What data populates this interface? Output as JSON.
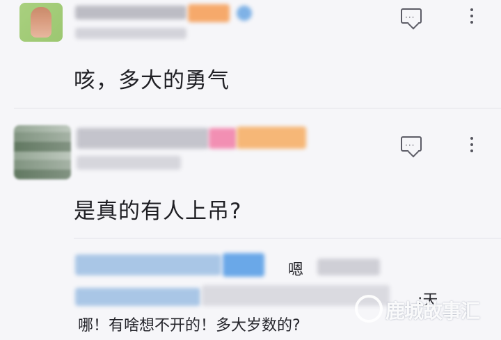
{
  "comments": [
    {
      "text": "咳，多大的勇气",
      "reply_icon": "comment-bubble-icon",
      "more_icon": "more-vertical-icon"
    },
    {
      "text": "是真的有人上吊?",
      "reply_icon": "comment-bubble-icon",
      "more_icon": "more-vertical-icon",
      "replies": [
        {
          "fragment": "嗯"
        },
        {
          "fragment": ":天"
        },
        {
          "fragment": "哪！有啥想不开的！多大岁数的?"
        }
      ]
    }
  ],
  "watermark": {
    "text": "鹿城故事汇"
  },
  "colors": {
    "background": "#f6f6f9",
    "text": "#1f1f24",
    "icon": "#5c5c66",
    "blur_blue": "#7fb2e6",
    "blur_orange": "#f6a96b",
    "blur_pink": "#f28fb3"
  }
}
